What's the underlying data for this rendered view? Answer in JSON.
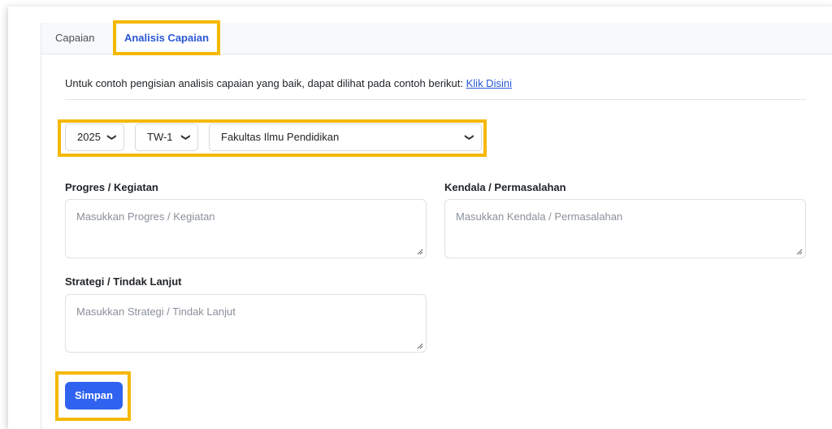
{
  "tabs": [
    {
      "label": "Capaian",
      "active": false
    },
    {
      "label": "Analisis Capaian",
      "active": true
    }
  ],
  "info": {
    "text": "Untuk contoh pengisian analisis capaian yang baik, dapat dilihat pada contoh berikut: ",
    "link_text": "Klik Disini"
  },
  "filters": {
    "year": "2025",
    "quarter": "TW-1",
    "unit": "Fakultas Ilmu Pendidikan"
  },
  "fields": {
    "progres": {
      "label": "Progres / Kegiatan",
      "placeholder": "Masukkan Progres / Kegiatan"
    },
    "kendala": {
      "label": "Kendala / Permasalahan",
      "placeholder": "Masukkan Kendala / Permasalahan"
    },
    "strategi": {
      "label": "Strategi / Tindak Lanjut",
      "placeholder": "Masukkan Strategi / Tindak Lanjut"
    }
  },
  "actions": {
    "save_label": "Simpan"
  },
  "colors": {
    "accent": "#2f63ef",
    "highlight": "#f5b800",
    "link": "#2b58d6"
  }
}
